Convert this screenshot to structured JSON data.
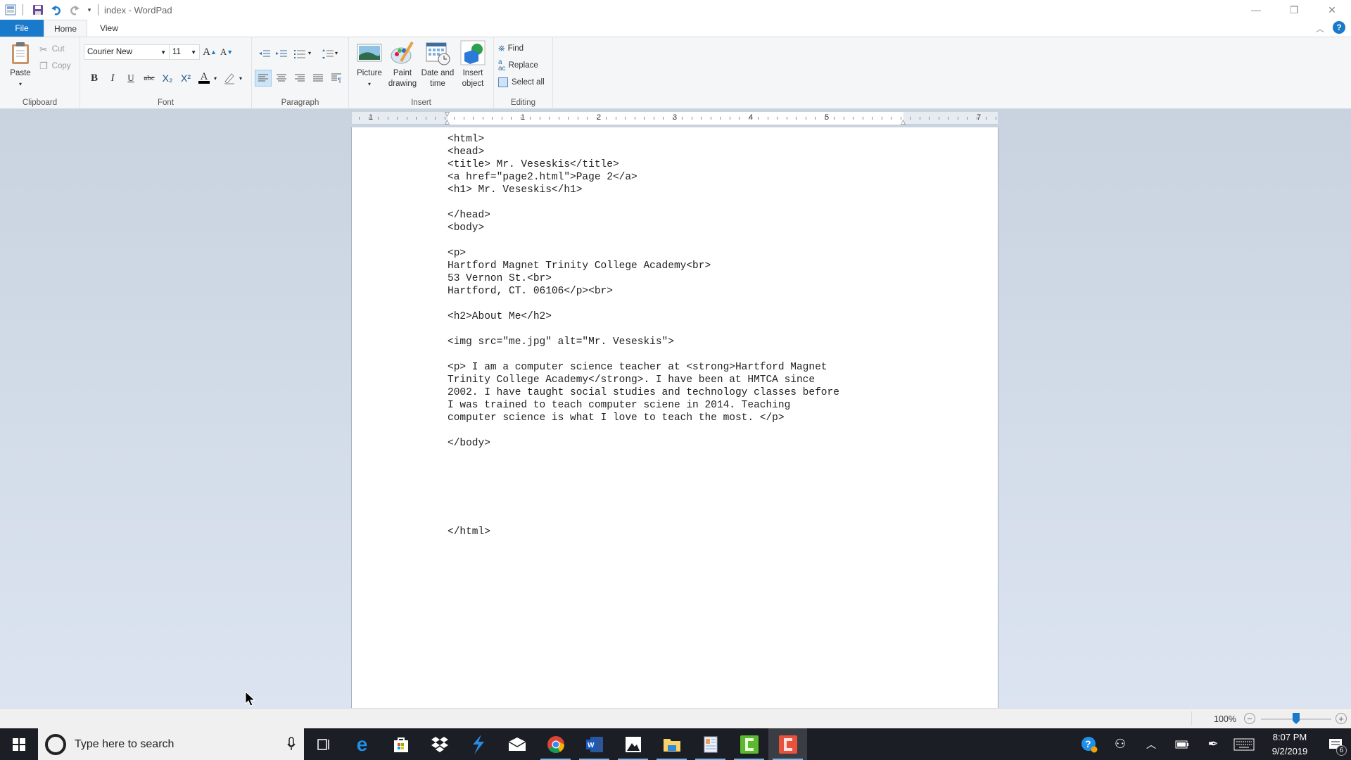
{
  "titlebar": {
    "title": "index - WordPad",
    "controls": {
      "minimize": "—",
      "restore": "❐",
      "close": "✕"
    }
  },
  "tabs": [
    {
      "label": "File"
    },
    {
      "label": "Home"
    },
    {
      "label": "View"
    }
  ],
  "ribbon": {
    "clipboard": {
      "label": "Clipboard",
      "paste": "Paste",
      "cut": "Cut",
      "copy": "Copy"
    },
    "font": {
      "label": "Font",
      "family": "Courier New",
      "size": "11",
      "bold": "B",
      "italic": "I",
      "underline": "U",
      "strike": "abc",
      "subscript": "X₂",
      "superscript": "X²",
      "grow": "A",
      "shrink": "A",
      "font_color": "#000000",
      "text_color_label": "A"
    },
    "paragraph": {
      "label": "Paragraph"
    },
    "insert": {
      "label": "Insert",
      "picture": "Picture",
      "paint_line1": "Paint",
      "paint_line2": "drawing",
      "datetime_line1": "Date and",
      "datetime_line2": "time",
      "object_line1": "Insert",
      "object_line2": "object"
    },
    "editing": {
      "label": "Editing",
      "find": "Find",
      "replace": "Replace",
      "select_all": "Select all"
    }
  },
  "ruler": {
    "labels": [
      "1",
      "1",
      "2",
      "3",
      "4",
      "5",
      "7"
    ]
  },
  "document": {
    "lines": [
      "<html>",
      "<head>",
      "<title> Mr. Veseskis</title>",
      "<a href=\"page2.html\">Page 2</a>",
      "<h1> Mr. Veseskis</h1>",
      "",
      "</head>",
      "<body>",
      "",
      "<p>",
      "Hartford Magnet Trinity College Academy<br>",
      "53 Vernon St.<br>",
      "Hartford, CT. 06106</p><br>",
      "",
      "<h2>About Me</h2>",
      "",
      "<img src=\"me.jpg\" alt=\"Mr. Veseskis\">",
      "",
      "<p> I am a computer science teacher at <strong>Hartford Magnet",
      "Trinity College Academy</strong>. I have been at HMTCA since",
      "2002. I have taught social studies and technology classes before",
      "I was trained to teach computer sciene in 2014. Teaching",
      "computer science is what I love to teach the most. </p>",
      "",
      "</body>",
      "",
      "",
      "",
      "",
      "",
      "",
      "</html>"
    ]
  },
  "statusbar": {
    "zoom": "100%",
    "zoom_out": "−",
    "zoom_in": "+",
    "zoom_fraction": 0.5
  },
  "taskbar": {
    "search_placeholder": "Type here to search",
    "apps": [
      "task-view",
      "edge",
      "store",
      "dropbox",
      "app-blue",
      "mail",
      "chrome",
      "word",
      "photos",
      "file-explorer",
      "wordpad",
      "camtasia-green",
      "camtasia-red"
    ],
    "time": "8:07 PM",
    "date": "9/2/2019",
    "notifications": "6"
  },
  "colors": {
    "accent": "#1979ca",
    "taskbar": "#1b1e24",
    "doc_bg": "#d3dcea"
  }
}
